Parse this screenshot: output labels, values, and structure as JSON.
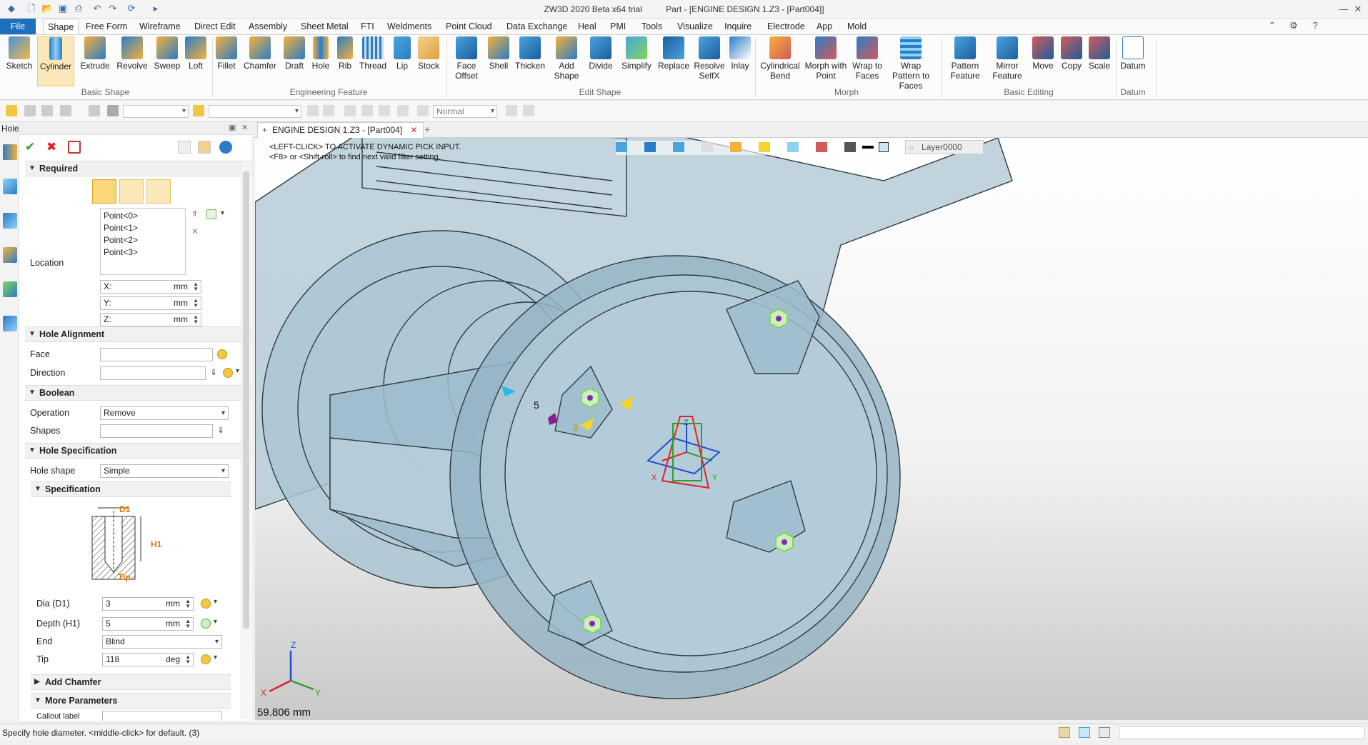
{
  "app": {
    "title": "ZW3D 2020 Beta x64 trial",
    "doc_title": "Part - [ENGINE DESIGN 1.Z3 - [Part004]]"
  },
  "menu": {
    "file": "File",
    "tabs": [
      "Shape",
      "Free Form",
      "Wireframe",
      "Direct Edit",
      "Assembly",
      "Sheet Metal",
      "FTI",
      "Weldments",
      "Point Cloud",
      "Data Exchange",
      "Heal",
      "PMI",
      "Tools",
      "Visualize",
      "Inquire",
      "Electrode",
      "App",
      "Mold"
    ],
    "active": "Shape"
  },
  "ribbon": {
    "basic_shape": {
      "label": "Basic Shape",
      "items": [
        "Sketch",
        "Cylinder",
        "Extrude",
        "Revolve",
        "Sweep",
        "Loft"
      ]
    },
    "engineering_feature": {
      "label": "Engineering Feature",
      "items": [
        "Fillet",
        "Chamfer",
        "Draft",
        "Hole",
        "Rib",
        "Thread",
        "Lip",
        "Stock"
      ]
    },
    "edit_shape": {
      "label": "Edit Shape",
      "items": [
        "Face Offset",
        "Shell",
        "Thicken",
        "Add Shape",
        "Divide",
        "Simplify",
        "Replace",
        "Resolve SelfX",
        "Inlay"
      ]
    },
    "morph": {
      "label": "Morph",
      "items": [
        "Cylindrical Bend",
        "Morph with Point",
        "Wrap to Faces",
        "Wrap Pattern to Faces"
      ]
    },
    "basic_editing": {
      "label": "Basic Editing",
      "items": [
        "Pattern Feature",
        "Mirror Feature",
        "Move",
        "Copy",
        "Scale"
      ]
    },
    "datum": {
      "label": "Datum",
      "items": [
        "Datum"
      ]
    }
  },
  "toolbar2": {
    "render_mode": "Normal"
  },
  "panel": {
    "title": "Hole",
    "required": {
      "section": "Required",
      "location_label": "Location",
      "points": [
        "Point<0>",
        "Point<1>",
        "Point<2>",
        "Point<3>"
      ],
      "x_label": "X:",
      "y_label": "Y:",
      "z_label": "Z:",
      "unit": "mm"
    },
    "hole_alignment": {
      "section": "Hole Alignment",
      "face_label": "Face",
      "direction_label": "Direction"
    },
    "boolean": {
      "section": "Boolean",
      "operation_label": "Operation",
      "operation_value": "Remove",
      "shapes_label": "Shapes"
    },
    "hole_spec": {
      "section": "Hole Specification",
      "shape_label": "Hole shape",
      "shape_value": "Simple",
      "spec_section": "Specification",
      "diagram": {
        "d1": "D1",
        "h1": "H1",
        "tip": "Tip"
      },
      "dia_label": "Dia (D1)",
      "dia_value": "3",
      "dia_unit": "mm",
      "depth_label": "Depth (H1)",
      "depth_value": "5",
      "depth_unit": "mm",
      "end_label": "End",
      "end_value": "Blind",
      "tip_label": "Tip",
      "tip_value": "118",
      "tip_unit": "deg"
    },
    "add_chamfer": "Add Chamfer",
    "more_params": "More Parameters",
    "callout_label": "Callout label"
  },
  "document_tab": "ENGINE DESIGN 1.Z3 - [Part004]",
  "viewport": {
    "hint1": "<LEFT-CLICK> TO ACTIVATE DYNAMIC PICK INPUT.",
    "hint2": "<F8> or <Shift-roll> to find next valid filter setting.",
    "layer": "Layer0000",
    "measure": "59.806 mm",
    "label5": "5",
    "label3": "3",
    "axis_x": "X",
    "axis_y": "Y",
    "axis_z": "Z"
  },
  "status": {
    "text": "Specify hole diameter.  <middle-click> for default. (3)"
  },
  "colors": {
    "accent": "#1f6fbf",
    "part": "#9fbfcf",
    "hole_marker": "#7ed957"
  }
}
